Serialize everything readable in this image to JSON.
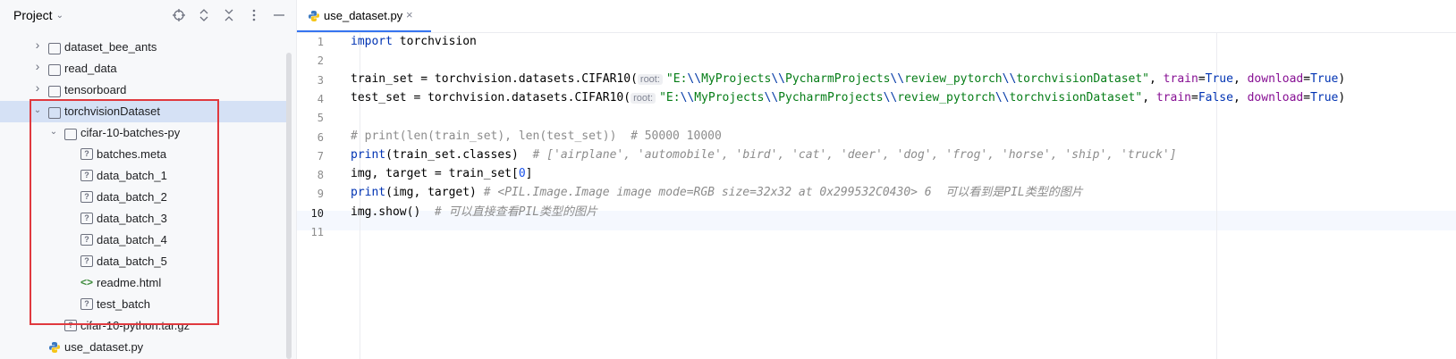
{
  "project_panel": {
    "title": "Project",
    "tree": [
      {
        "label": "dataset_bee_ants",
        "type": "folder",
        "depth": 1,
        "expanded": false
      },
      {
        "label": "read_data",
        "type": "folder",
        "depth": 1,
        "expanded": false
      },
      {
        "label": "tensorboard",
        "type": "folder",
        "depth": 1,
        "expanded": false
      },
      {
        "label": "torchvisionDataset",
        "type": "folder",
        "depth": 1,
        "expanded": true,
        "selected": true
      },
      {
        "label": "cifar-10-batches-py",
        "type": "folder",
        "depth": 2,
        "expanded": true
      },
      {
        "label": "batches.meta",
        "type": "unknown",
        "depth": 3
      },
      {
        "label": "data_batch_1",
        "type": "unknown",
        "depth": 3
      },
      {
        "label": "data_batch_2",
        "type": "unknown",
        "depth": 3
      },
      {
        "label": "data_batch_3",
        "type": "unknown",
        "depth": 3
      },
      {
        "label": "data_batch_4",
        "type": "unknown",
        "depth": 3
      },
      {
        "label": "data_batch_5",
        "type": "unknown",
        "depth": 3
      },
      {
        "label": "readme.html",
        "type": "html",
        "depth": 3
      },
      {
        "label": "test_batch",
        "type": "unknown",
        "depth": 3
      },
      {
        "label": "cifar-10-python.tar.gz",
        "type": "unknown",
        "depth": 2
      },
      {
        "label": "use_dataset.py",
        "type": "python",
        "depth": 1
      }
    ],
    "icons": {
      "html": "<>",
      "unknown": "?"
    }
  },
  "editor": {
    "tab": {
      "label": "use_dataset.py",
      "close": "×"
    },
    "current_line": 10,
    "line_numbers": [
      "1",
      "2",
      "3",
      "4",
      "5",
      "6",
      "7",
      "8",
      "9",
      "10",
      "11"
    ],
    "hint_root": "root:",
    "lines": {
      "l1_kw": "import",
      "l1_rest": " torchvision",
      "l3_a": "train_set = torchvision.datasets.CIFAR10(",
      "l3_path_a": "\"E:",
      "l3_esc": "\\\\",
      "l3_path_b": "MyProjects",
      "l3_path_c": "PycharmProjects",
      "l3_path_d": "review_pytorch",
      "l3_path_e": "torchvisionDataset\"",
      "l3_sep": ", ",
      "l3_kw_train": "train",
      "eq": "=",
      "l3_true": "True",
      "l3_kw_download": "download",
      "close_paren": ")",
      "l4_a": "test_set = torchvision.datasets.CIFAR10(",
      "l4_false": "False",
      "l6": "# print(len(train_set), len(test_set))  # 50000 10000",
      "l7_kw": "print",
      "l7_rest": "(train_set.classes)  ",
      "l7_cmt": "# ['airplane', 'automobile', 'bird', 'cat', 'deer', 'dog', 'frog', 'horse', 'ship', 'truck']",
      "l8_a": "img, target = train_set[",
      "l8_num": "0",
      "l8_b": "]",
      "l9_kw": "print",
      "l9_rest": "(img, target) ",
      "l9_cmt": "# <PIL.Image.Image image mode=RGB size=32x32 at 0x299532C0430> 6  可以看到是PIL类型的图片",
      "l10_a": "img.show()  ",
      "l10_cmt": "# 可以直接查看PIL类型的图片"
    }
  },
  "colors": {
    "keyword": "#0033b3",
    "string": "#067d17",
    "kwarg": "#871094",
    "number": "#1750eb",
    "comment": "#8c8c8c",
    "selection": "#d5e1f5",
    "highlight_box": "#e0393e",
    "tab_accent": "#3574f0"
  }
}
